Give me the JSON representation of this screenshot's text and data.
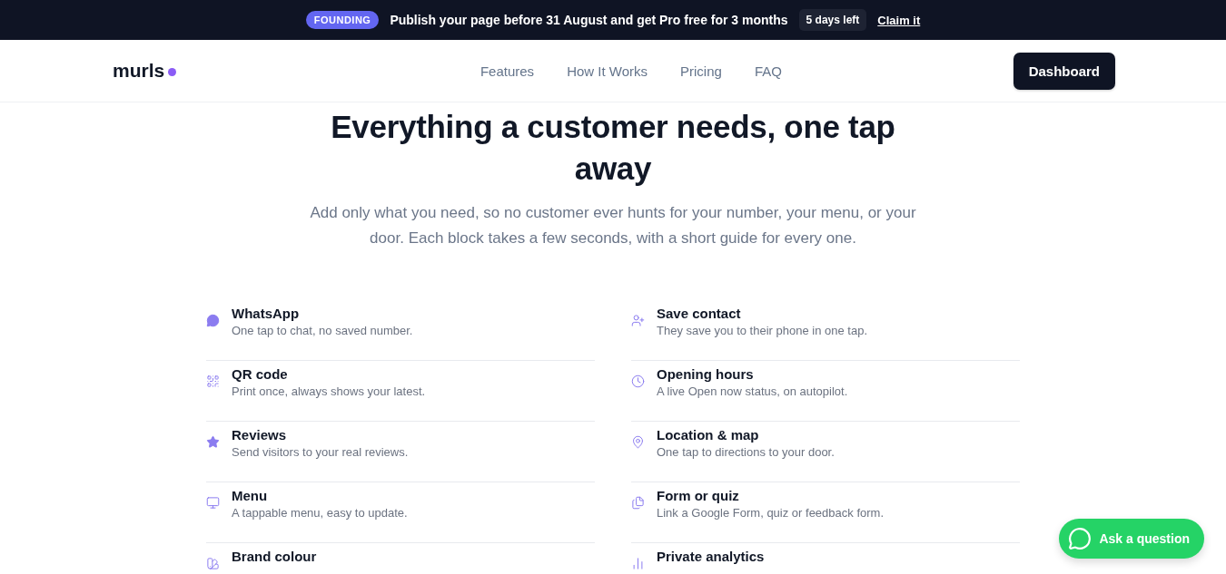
{
  "banner": {
    "badge": "FOUNDING",
    "message": "Publish your page before 31 August and get Pro free for 3 months",
    "countdown": "5 days left",
    "link": "Claim it"
  },
  "nav": {
    "logo": "murls",
    "links": [
      "Features",
      "How It Works",
      "Pricing",
      "FAQ"
    ],
    "cta": "Dashboard"
  },
  "hero": {
    "title": "Everything a customer needs, one tap away",
    "subtitle": "Add only what you need, so no customer ever hunts for your number, your menu, or your door. Each block takes a few seconds, with a short guide for every one."
  },
  "features": [
    {
      "title": "WhatsApp",
      "description": "One tap to chat, no saved number."
    },
    {
      "title": "Save contact",
      "description": "They save you to their phone in one tap."
    },
    {
      "title": "QR code",
      "description": "Print once, always shows your latest."
    },
    {
      "title": "Opening hours",
      "description": "A live Open now status, on autopilot."
    },
    {
      "title": "Reviews",
      "description": "Send visitors to your real reviews."
    },
    {
      "title": "Location & map",
      "description": "One tap to directions to your door."
    },
    {
      "title": "Menu",
      "description": "A tappable menu, easy to update."
    },
    {
      "title": "Form or quiz",
      "description": "Link a Google Form, quiz or feedback form."
    },
    {
      "title": "Brand colour"
    },
    {
      "title": "Private analytics"
    }
  ],
  "chat_button": {
    "label": "Ask a question"
  }
}
